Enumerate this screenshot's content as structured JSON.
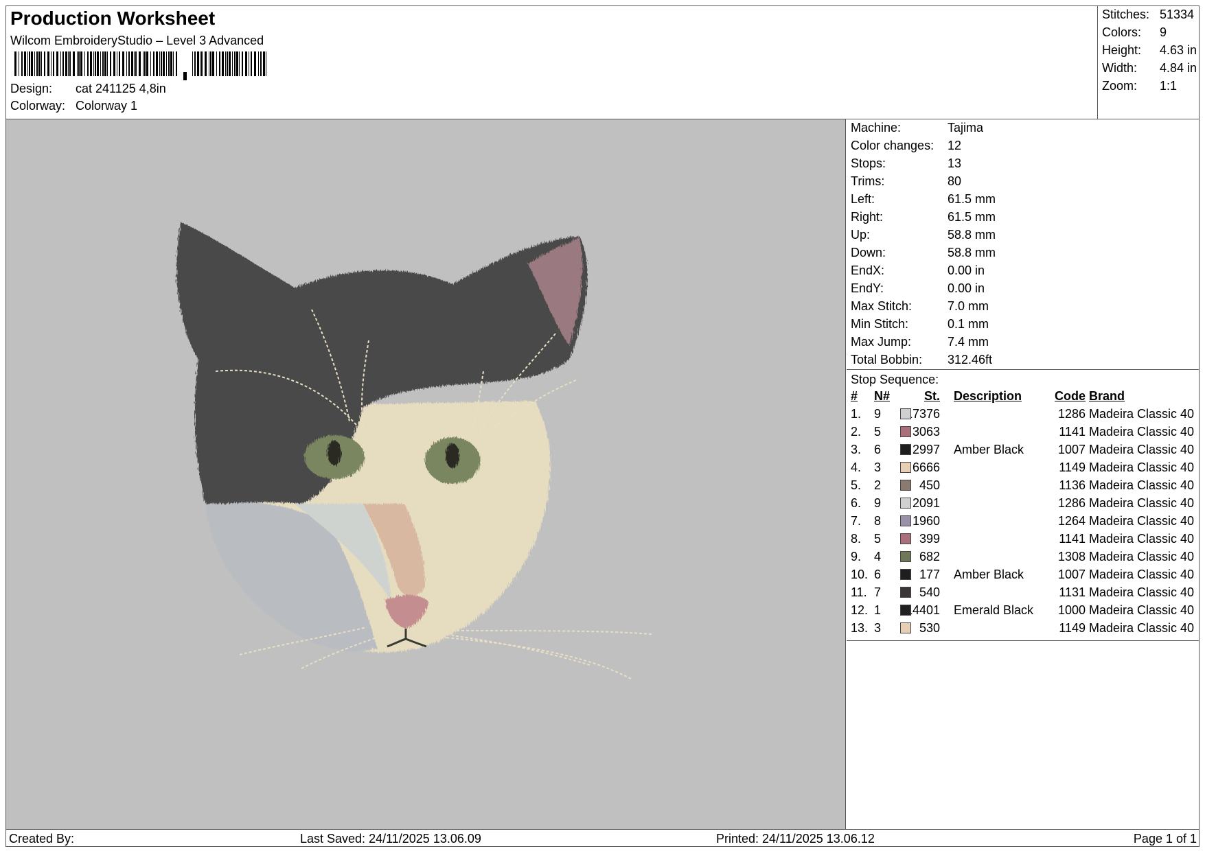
{
  "header": {
    "title": "Production Worksheet",
    "subtitle": "Wilcom EmbroideryStudio – Level 3 Advanced",
    "design_label": "Design:",
    "design_value": "cat 241125 4,8in",
    "colorway_label": "Colorway:",
    "colorway_value": "Colorway 1"
  },
  "stats": [
    {
      "label": "Stitches:",
      "value": "51334"
    },
    {
      "label": "Colors:",
      "value": "9"
    },
    {
      "label": "Height:",
      "value": "4.63 in"
    },
    {
      "label": "Width:",
      "value": "4.84 in"
    },
    {
      "label": "Zoom:",
      "value": "1:1"
    }
  ],
  "machine": [
    {
      "label": "Machine:",
      "value": "Tajima"
    },
    {
      "label": "Color changes:",
      "value": "12"
    },
    {
      "label": "Stops:",
      "value": "13"
    },
    {
      "label": "Trims:",
      "value": "80"
    },
    {
      "label": "Left:",
      "value": "61.5 mm"
    },
    {
      "label": "Right:",
      "value": "61.5 mm"
    },
    {
      "label": "Up:",
      "value": "58.8 mm"
    },
    {
      "label": "Down:",
      "value": "58.8 mm"
    },
    {
      "label": "EndX:",
      "value": "0.00 in"
    },
    {
      "label": "EndY:",
      "value": "0.00 in"
    },
    {
      "label": "Max Stitch:",
      "value": "7.0 mm"
    },
    {
      "label": "Min Stitch:",
      "value": "0.1 mm"
    },
    {
      "label": "Max Jump:",
      "value": "7.4 mm"
    },
    {
      "label": "Total Bobbin:",
      "value": "312.46ft"
    }
  ],
  "stop_sequence": {
    "title": "Stop Sequence:",
    "headers": {
      "num": "#",
      "needle": "N#",
      "stitches": "St.",
      "description": "Description",
      "code": "Code",
      "brand": "Brand"
    },
    "rows": [
      {
        "num": "1.",
        "needle": "9",
        "color": "#d0d0d0",
        "stitches": "17376",
        "description": "",
        "code": "1286",
        "brand": "Madeira Classic 40"
      },
      {
        "num": "2.",
        "needle": "5",
        "color": "#a8707a",
        "stitches": "3063",
        "description": "",
        "code": "1141",
        "brand": "Madeira Classic 40"
      },
      {
        "num": "3.",
        "needle": "6",
        "color": "#1e1e1e",
        "stitches": "2997",
        "description": "Amber Black",
        "code": "1007",
        "brand": "Madeira Classic 40"
      },
      {
        "num": "4.",
        "needle": "3",
        "color": "#e6cfb4",
        "stitches": "6666",
        "description": "",
        "code": "1149",
        "brand": "Madeira Classic 40"
      },
      {
        "num": "5.",
        "needle": "2",
        "color": "#8a7a70",
        "stitches": "450",
        "description": "",
        "code": "1136",
        "brand": "Madeira Classic 40"
      },
      {
        "num": "6.",
        "needle": "9",
        "color": "#d0d0d0",
        "stitches": "2091",
        "description": "",
        "code": "1286",
        "brand": "Madeira Classic 40"
      },
      {
        "num": "7.",
        "needle": "8",
        "color": "#9a90a8",
        "stitches": "1960",
        "description": "",
        "code": "1264",
        "brand": "Madeira Classic 40"
      },
      {
        "num": "8.",
        "needle": "5",
        "color": "#a8707a",
        "stitches": "399",
        "description": "",
        "code": "1141",
        "brand": "Madeira Classic 40"
      },
      {
        "num": "9.",
        "needle": "4",
        "color": "#6e7858",
        "stitches": "682",
        "description": "",
        "code": "1308",
        "brand": "Madeira Classic 40"
      },
      {
        "num": "10.",
        "needle": "6",
        "color": "#1e1e1e",
        "stitches": "177",
        "description": "Amber Black",
        "code": "1007",
        "brand": "Madeira Classic 40"
      },
      {
        "num": "11.",
        "needle": "7",
        "color": "#3a3636",
        "stitches": "540",
        "description": "",
        "code": "1131",
        "brand": "Madeira Classic 40"
      },
      {
        "num": "12.",
        "needle": "1",
        "color": "#202020",
        "stitches": "14401",
        "description": "Emerald Black",
        "code": "1000",
        "brand": "Madeira Classic 40"
      },
      {
        "num": "13.",
        "needle": "3",
        "color": "#e6cfb4",
        "stitches": "530",
        "description": "",
        "code": "1149",
        "brand": "Madeira Classic 40"
      }
    ]
  },
  "footer": {
    "created_by": "Created By:",
    "last_saved": "Last Saved: 24/11/2025 13.06.09",
    "printed": "Printed: 24/11/2025 13.06.12",
    "page": "Page 1 of 1"
  }
}
